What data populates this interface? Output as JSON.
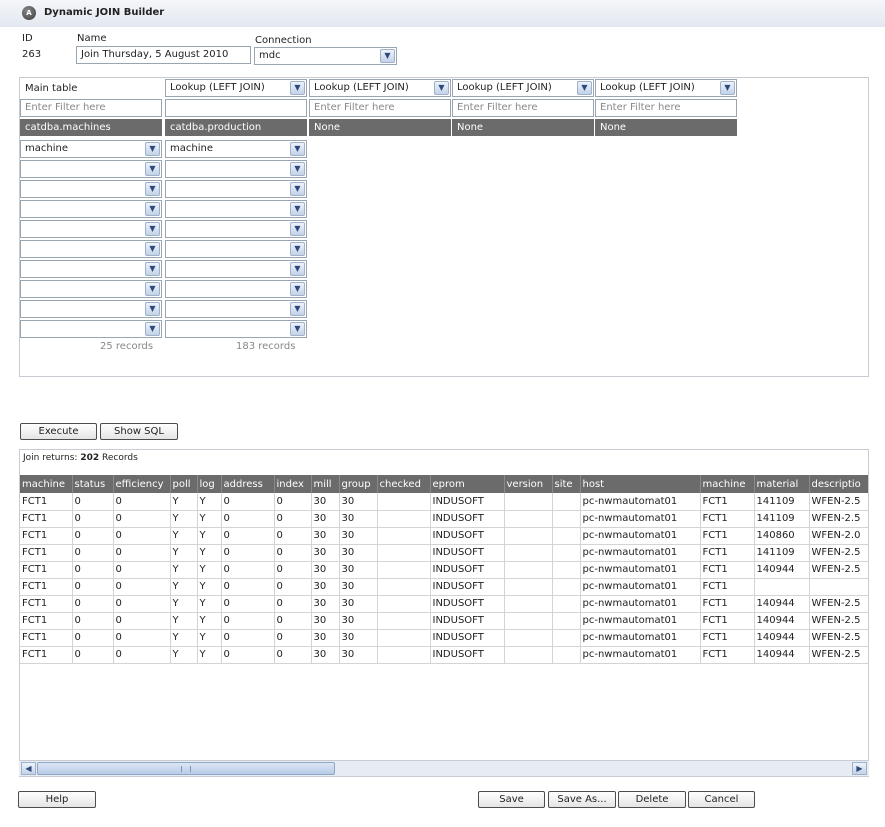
{
  "app": {
    "title": "Dynamic JOIN Builder",
    "icon": "app-logo-icon"
  },
  "meta": {
    "id_label": "ID",
    "id_value": "263",
    "name_label": "Name",
    "name_value": "Join Thursday, 5 August 2010",
    "connection_label": "Connection",
    "connection_value": "mdc"
  },
  "join_builder": {
    "main_table_label": "Main table",
    "lookup_options": [
      "Lookup (LEFT JOIN)",
      "Lookup (LEFT JOIN)",
      "Lookup (LEFT JOIN)",
      "Lookup (LEFT JOIN)"
    ],
    "filter_placeholder": "Enter Filter here",
    "filters": [
      "",
      "",
      "",
      "",
      ""
    ],
    "tables": [
      "catdba.machines",
      "catdba.production",
      "None",
      "None",
      "None"
    ],
    "col1_fields": [
      "machine",
      "",
      "",
      "",
      "",
      "",
      "",
      "",
      "",
      ""
    ],
    "col2_fields": [
      "machine",
      "",
      "",
      "",
      "",
      "",
      "",
      "",
      "",
      ""
    ],
    "records": [
      "25 records",
      "183 records"
    ]
  },
  "actions": {
    "execute": "Execute",
    "show_sql": "Show SQL"
  },
  "results": {
    "join_returns_prefix": "Join returns:",
    "count": "202",
    "records_suffix": "Records",
    "columns": [
      "machine",
      "status",
      "efficiency",
      "poll",
      "log",
      "address",
      "index",
      "mill",
      "group",
      "checked",
      "eprom",
      "version",
      "site",
      "host",
      "machine",
      "material",
      "descriptio"
    ],
    "rows": [
      [
        "FCT1",
        "0",
        "0",
        "Y",
        "Y",
        "0",
        "0",
        "30",
        "30",
        "",
        "INDUSOFT",
        "",
        "",
        "pc-nwmautomat01",
        "FCT1",
        "141109",
        "WFEN-2.5"
      ],
      [
        "FCT1",
        "0",
        "0",
        "Y",
        "Y",
        "0",
        "0",
        "30",
        "30",
        "",
        "INDUSOFT",
        "",
        "",
        "pc-nwmautomat01",
        "FCT1",
        "141109",
        "WFEN-2.5"
      ],
      [
        "FCT1",
        "0",
        "0",
        "Y",
        "Y",
        "0",
        "0",
        "30",
        "30",
        "",
        "INDUSOFT",
        "",
        "",
        "pc-nwmautomat01",
        "FCT1",
        "140860",
        "WFEN-2.0"
      ],
      [
        "FCT1",
        "0",
        "0",
        "Y",
        "Y",
        "0",
        "0",
        "30",
        "30",
        "",
        "INDUSOFT",
        "",
        "",
        "pc-nwmautomat01",
        "FCT1",
        "141109",
        "WFEN-2.5"
      ],
      [
        "FCT1",
        "0",
        "0",
        "Y",
        "Y",
        "0",
        "0",
        "30",
        "30",
        "",
        "INDUSOFT",
        "",
        "",
        "pc-nwmautomat01",
        "FCT1",
        "140944",
        "WFEN-2.5"
      ],
      [
        "FCT1",
        "0",
        "0",
        "Y",
        "Y",
        "0",
        "0",
        "30",
        "30",
        "",
        "INDUSOFT",
        "",
        "",
        "pc-nwmautomat01",
        "FCT1",
        "",
        ""
      ],
      [
        "FCT1",
        "0",
        "0",
        "Y",
        "Y",
        "0",
        "0",
        "30",
        "30",
        "",
        "INDUSOFT",
        "",
        "",
        "pc-nwmautomat01",
        "FCT1",
        "140944",
        "WFEN-2.5"
      ],
      [
        "FCT1",
        "0",
        "0",
        "Y",
        "Y",
        "0",
        "0",
        "30",
        "30",
        "",
        "INDUSOFT",
        "",
        "",
        "pc-nwmautomat01",
        "FCT1",
        "140944",
        "WFEN-2.5"
      ],
      [
        "FCT1",
        "0",
        "0",
        "Y",
        "Y",
        "0",
        "0",
        "30",
        "30",
        "",
        "INDUSOFT",
        "",
        "",
        "pc-nwmautomat01",
        "FCT1",
        "140944",
        "WFEN-2.5"
      ],
      [
        "FCT1",
        "0",
        "0",
        "Y",
        "Y",
        "0",
        "0",
        "30",
        "30",
        "",
        "INDUSOFT",
        "",
        "",
        "pc-nwmautomat01",
        "FCT1",
        "140944",
        "WFEN-2.5"
      ]
    ]
  },
  "footer": {
    "help": "Help",
    "save": "Save",
    "save_as": "Save As...",
    "delete": "Delete",
    "cancel": "Cancel"
  },
  "colors": {
    "header_bg": "#6b6b6b",
    "button_border": "#4d4d4d",
    "dropdown_accent": "#2c4a7c"
  }
}
